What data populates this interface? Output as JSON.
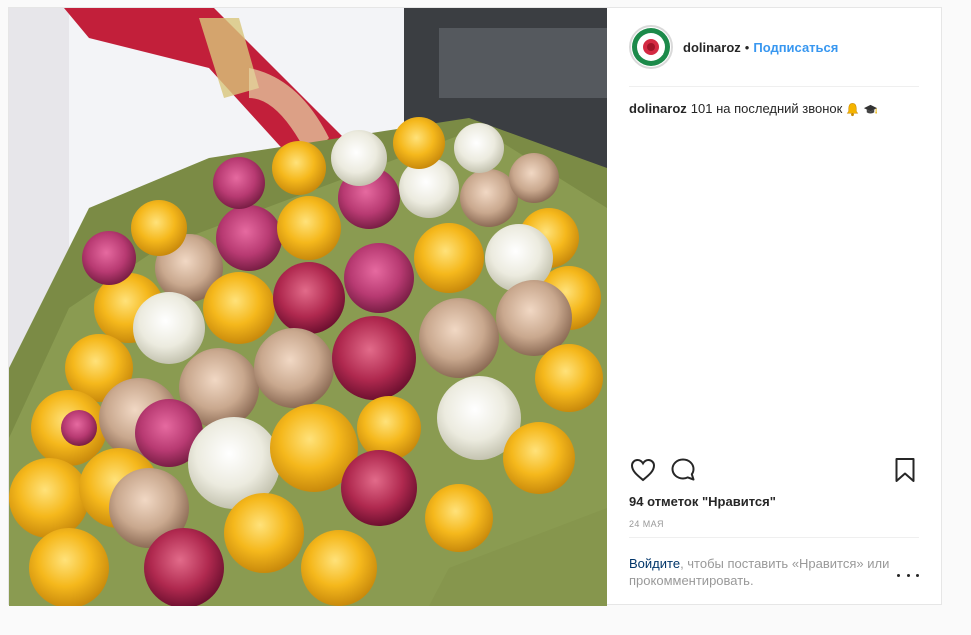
{
  "post": {
    "photo_alt": "Букет роз",
    "author": {
      "username": "dolinaroz",
      "avatar_text_top": "ДОЛИНА",
      "avatar_text_bottom": "РОЗ"
    },
    "follow_separator": "•",
    "follow_label": "Подписаться",
    "caption": {
      "username": "dolinaroz",
      "text": "101 на последний звонок",
      "emojis": [
        "bell-icon",
        "graduation-cap-icon"
      ]
    },
    "likes_text": "94 отметок \"Нравится\"",
    "date": "24 МАЯ",
    "login_prompt": {
      "link": "Войдите",
      "rest": ", чтобы поставить «Нравится» или прокомментировать."
    }
  },
  "icons": {
    "like": "heart-icon",
    "comment": "comment-icon",
    "save": "bookmark-icon",
    "more": "more-options-icon"
  }
}
